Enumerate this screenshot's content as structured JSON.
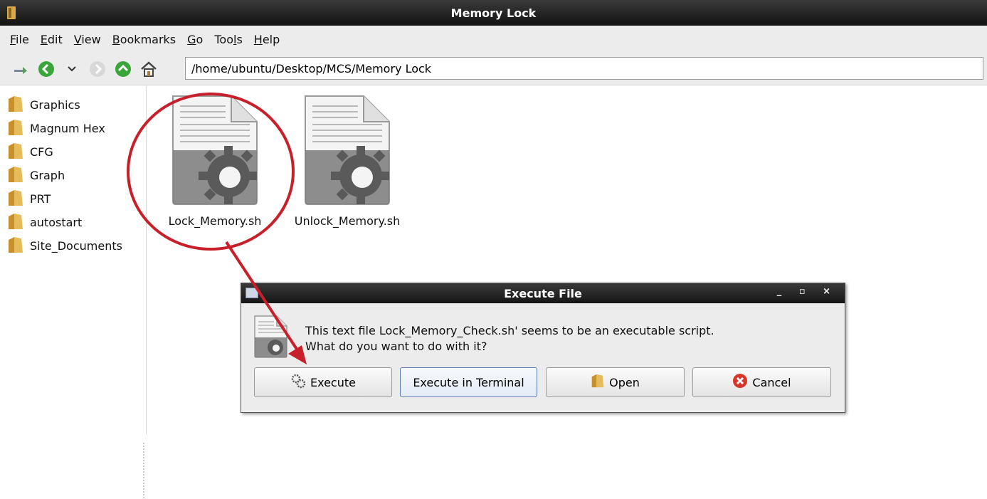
{
  "window": {
    "title": "Memory Lock",
    "icon": "folder-icon"
  },
  "menubar": {
    "items": [
      {
        "label": "File",
        "mnemonic": "F"
      },
      {
        "label": "Edit",
        "mnemonic": "E"
      },
      {
        "label": "View",
        "mnemonic": "V"
      },
      {
        "label": "Bookmarks",
        "mnemonic": "B"
      },
      {
        "label": "Go",
        "mnemonic": "G"
      },
      {
        "label": "Tools",
        "mnemonic": "l"
      },
      {
        "label": "Help",
        "mnemonic": "H"
      }
    ]
  },
  "toolbar": {
    "icons": [
      "new-tab-icon",
      "back-icon",
      "history-dropdown-icon",
      "forward-icon",
      "up-icon",
      "home-icon"
    ],
    "address": "/home/ubuntu/Desktop/MCS/Memory Lock"
  },
  "sidebar": {
    "items": [
      {
        "label": "Graphics"
      },
      {
        "label": "Magnum Hex"
      },
      {
        "label": "CFG"
      },
      {
        "label": "Graph"
      },
      {
        "label": "PRT"
      },
      {
        "label": "autostart"
      },
      {
        "label": "Site_Documents"
      }
    ]
  },
  "files": [
    {
      "name": "Lock_Memory.sh",
      "icon": "script-file-icon",
      "highlighted": true
    },
    {
      "name": "Unlock_Memory.sh",
      "icon": "script-file-icon",
      "highlighted": false
    }
  ],
  "dialog": {
    "title": "Execute File",
    "window_controls": "_ ▫ ×",
    "message_line1": "This text file  Lock_Memory_Check.sh' seems to be an executable script.",
    "message_line2": "What do you want to do with it?",
    "buttons": {
      "execute": "Execute",
      "execute_terminal": "Execute in Terminal",
      "open": "Open",
      "cancel": "Cancel"
    }
  },
  "colors": {
    "annotation": "#c8202a",
    "titlebar": "#1e1e1e",
    "folder": "#d9a84a",
    "back_green": "#3aa53a"
  }
}
